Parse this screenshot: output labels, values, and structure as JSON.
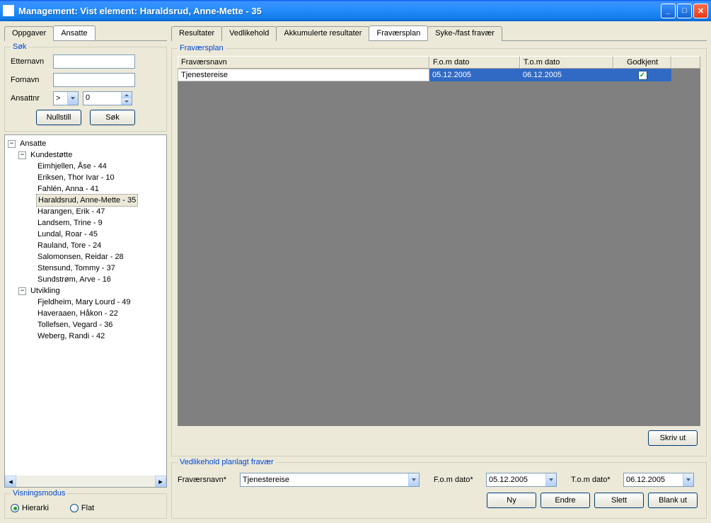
{
  "titlebar": {
    "title": "Management: Vist element: Haraldsrud, Anne-Mette - 35"
  },
  "leftTabs": {
    "oppgaver": "Oppgaver",
    "ansatte": "Ansatte"
  },
  "search": {
    "legend": "Søk",
    "etternavn_label": "Etternavn",
    "fornavn_label": "Fornavn",
    "ansattnr_label": "Ansattnr",
    "op": ">",
    "ansattnr_val": "0",
    "nullstill": "Nullstill",
    "sok": "Søk"
  },
  "tree": {
    "root": "Ansatte",
    "grp1": "Kundestøtte",
    "grp1_items": [
      "Eimhjellen, Åse - 44",
      "Eriksen, Thor Ivar - 10",
      "Fahlén, Anna - 41",
      "Haraldsrud, Anne-Mette - 35",
      "Harangen, Erik - 47",
      "Landsem, Trine - 9",
      "Lundal, Roar - 45",
      "Rauland, Tore - 24",
      "Salomonsen, Reidar - 28",
      "Stensund, Tommy - 37",
      "Sundstrøm, Arve - 16"
    ],
    "grp2": "Utvikling",
    "grp2_items": [
      "Fjeldheim, Mary Lourd - 49",
      "Haveraaen, Håkon - 22",
      "Tollefsen, Vegard - 36",
      "Weberg, Randi - 42"
    ]
  },
  "viewmode": {
    "legend": "Visningsmodus",
    "hierarki": "Hierarki",
    "flat": "Flat"
  },
  "rightTabs": {
    "resultater": "Resultater",
    "vedlikehold": "Vedlikehold",
    "akkum": "Akkumulerte resultater",
    "fravaersplan": "Fraværsplan",
    "syke": "Syke-/fast fravær"
  },
  "table": {
    "legend": "Fraværsplan",
    "headers": {
      "navn": "Fraværsnavn",
      "fom": "F.o.m dato",
      "tom": "T.o.m dato",
      "godkjent": "Godkjent"
    },
    "row": {
      "navn": "Tjenestereise",
      "fom": "05.12.2005",
      "tom": "06.12.2005",
      "godkjent": true
    }
  },
  "skrivut": "Skriv ut",
  "maint": {
    "legend": "Vedlikehold planlagt fravær",
    "navn_label": "Fraværsnavn*",
    "navn_val": "Tjenestereise",
    "fom_label": "F.o.m dato*",
    "fom_val": "05.12.2005",
    "tom_label": "T.o.m dato*",
    "tom_val": "06.12.2005",
    "ny": "Ny",
    "endre": "Endre",
    "slett": "Slett",
    "blank": "Blank ut"
  }
}
